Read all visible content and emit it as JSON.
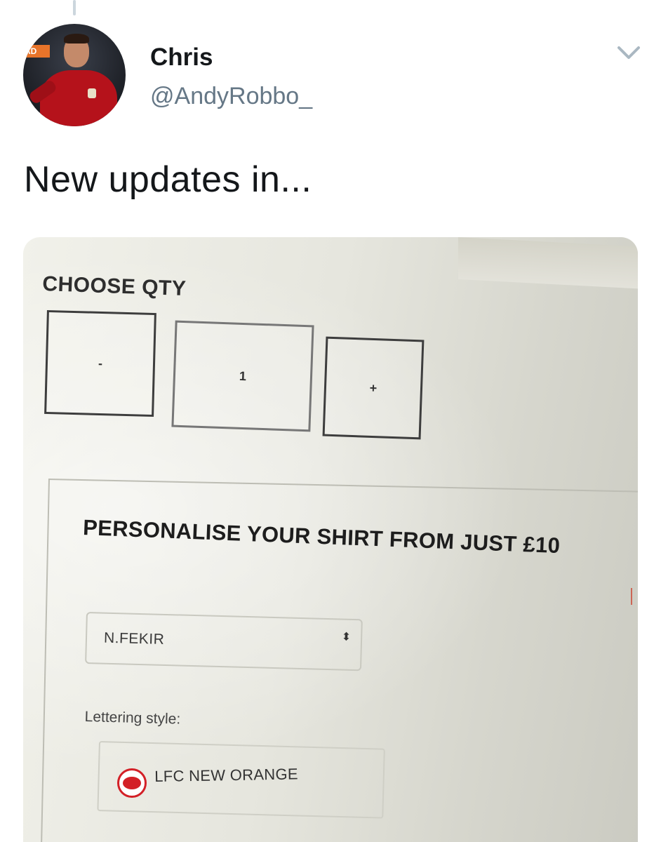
{
  "tweet": {
    "display_name": "Chris",
    "handle": "@AndyRobbo_",
    "text": "New updates in..."
  },
  "avatar": {
    "banner_text": "AD"
  },
  "photo": {
    "choose_qty_label": "CHOOSE QTY",
    "qty_minus_label": "-",
    "qty_value": "1",
    "qty_plus_label": "+",
    "personalise_title": "PERSONALISE YOUR SHIRT FROM JUST £10",
    "name_select_value": "N.FEKIR",
    "name_select_arrows": "⬍",
    "lettering_label": "Lettering style:",
    "lettering_option": "LFC NEW ORANGE"
  },
  "icons": {
    "menu": "chevron-down-icon",
    "radio": "radio-selected-icon"
  },
  "colors": {
    "handle": "#657786",
    "radio_accent": "#d32027"
  }
}
